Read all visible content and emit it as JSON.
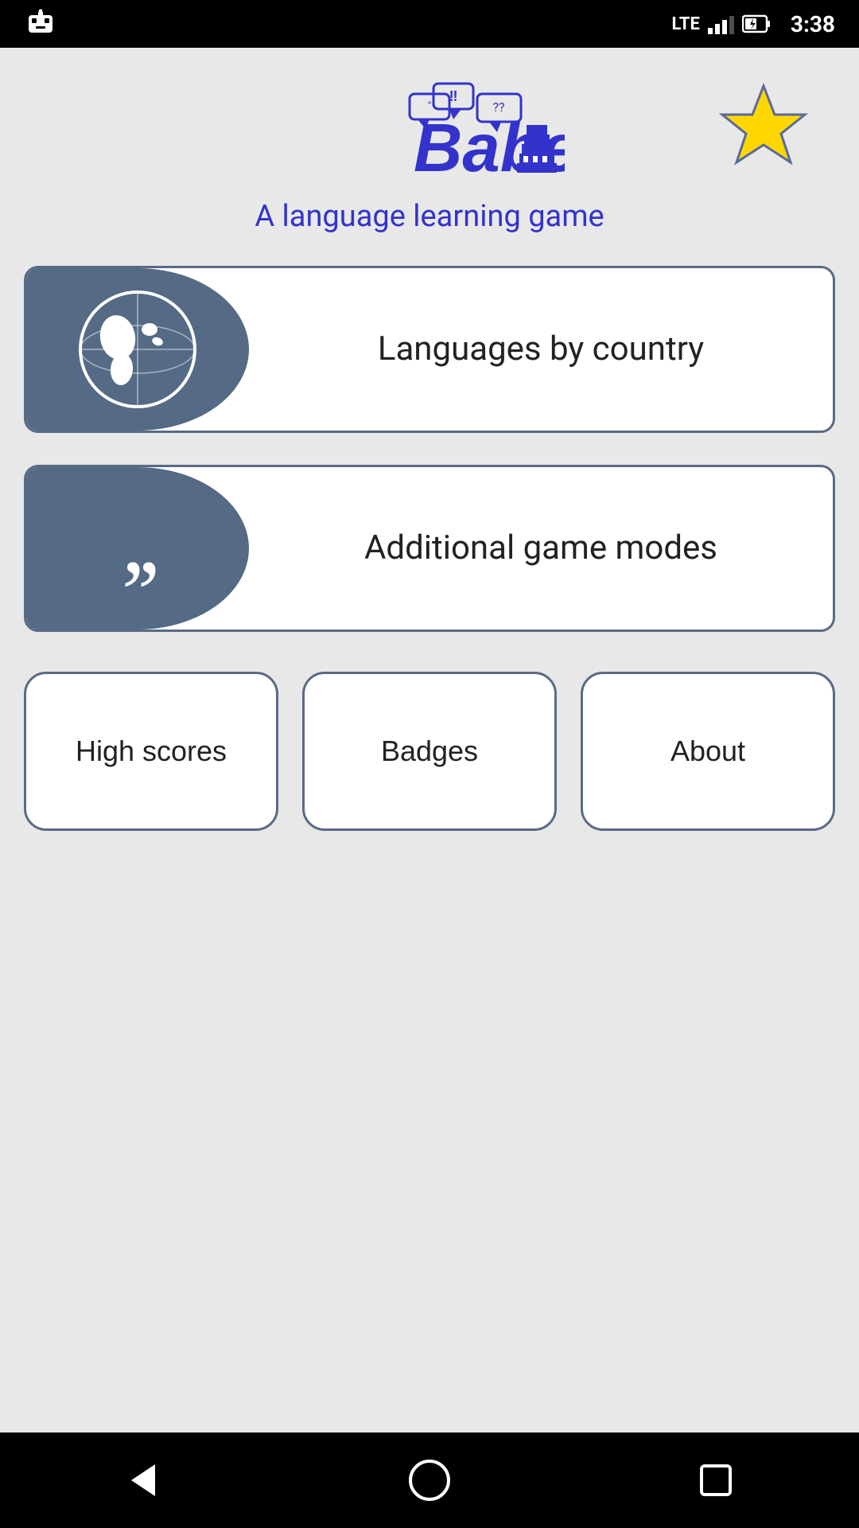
{
  "statusBar": {
    "time": "3:38",
    "network": "LTE"
  },
  "header": {
    "subtitle": "A language learning game",
    "starAlt": "favorites-star"
  },
  "cards": [
    {
      "id": "languages-by-country",
      "label": "Languages by\ncountry",
      "iconType": "globe"
    },
    {
      "id": "additional-game-modes",
      "label": "Additional game modes",
      "iconType": "quotes"
    }
  ],
  "bottomButtons": [
    {
      "id": "high-scores",
      "label": "High scores"
    },
    {
      "id": "badges",
      "label": "Badges"
    },
    {
      "id": "about",
      "label": "About"
    }
  ],
  "navBar": {
    "back": "◁",
    "home": "○",
    "recents": "□"
  }
}
